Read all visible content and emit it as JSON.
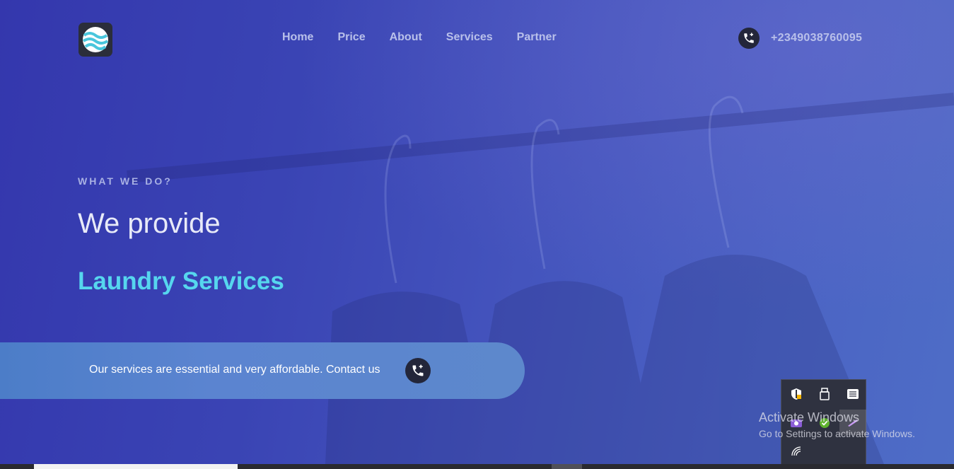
{
  "header": {
    "logo_icon": "globe-wave-logo-icon",
    "nav": [
      {
        "label": "Home"
      },
      {
        "label": "Price"
      },
      {
        "label": "About"
      },
      {
        "label": "Services"
      },
      {
        "label": "Partner"
      }
    ],
    "phone_icon": "phone-add-icon",
    "phone_number": "+2349038760095"
  },
  "hero": {
    "eyebrow": "WHAT WE DO?",
    "heading": "We provide",
    "subheading": "Laundry Services",
    "cta_text": "Our services are essential and very affordable. Contact us",
    "cta_icon": "phone-add-icon"
  },
  "system_tray": {
    "icons": [
      "defender-warning-icon",
      "usb-drive-icon",
      "settings-panel-icon",
      "camera-app-icon",
      "check-shield-icon",
      "pen-icon",
      "wifi-icon"
    ]
  },
  "watermark": {
    "line1": "Activate Windows",
    "line2": "Go to Settings to activate Windows."
  },
  "colors": {
    "accent": "#56d6ee",
    "nav_text": "#b9c0ea",
    "hero_bg": "#3a44b4"
  }
}
